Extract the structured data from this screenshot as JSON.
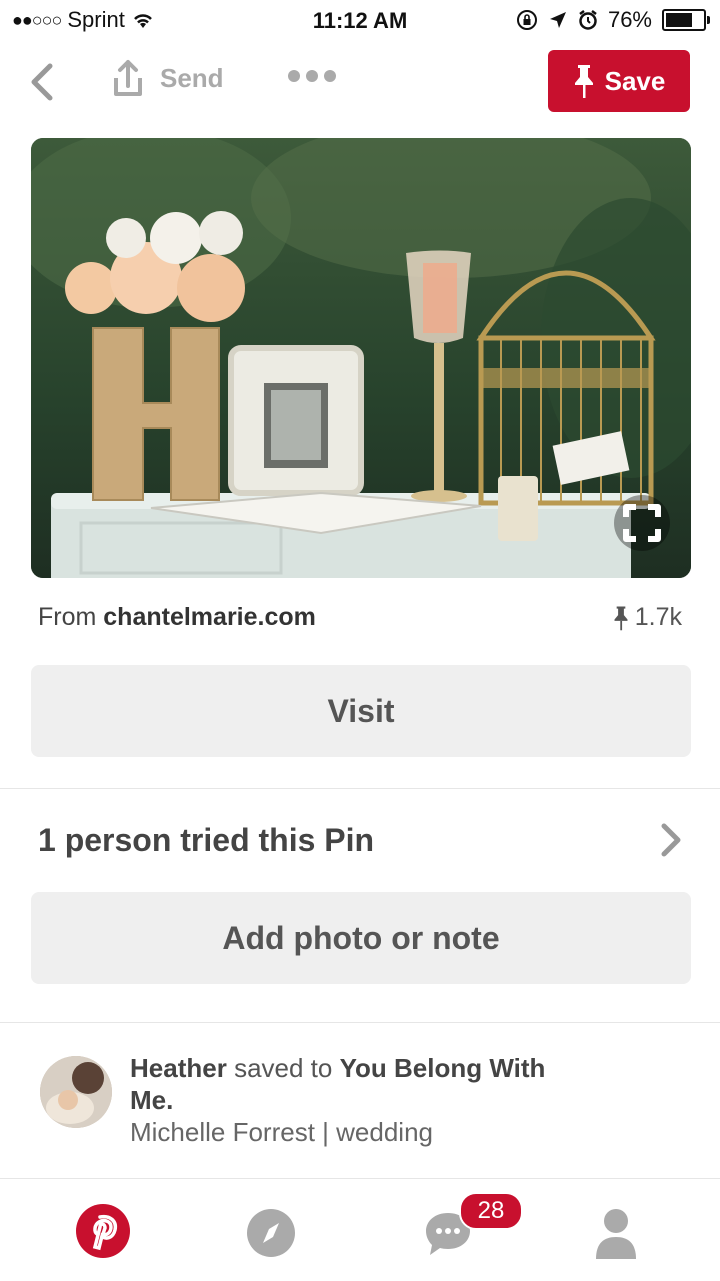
{
  "status_bar": {
    "signal": "●●○○○",
    "carrier": "Sprint",
    "time": "11:12 AM",
    "battery": "76%",
    "battery_level": 0.76
  },
  "nav": {
    "send_label": "Send",
    "save_label": "Save"
  },
  "pin": {
    "source_prefix": "From",
    "source_domain": "chantelmarie.com",
    "save_count": "1.7k"
  },
  "visit_label": "Visit",
  "tried": {
    "label": "1 person tried this Pin",
    "add_label": "Add photo or note"
  },
  "activity": {
    "user": "Heather",
    "verb": "saved to",
    "board": "You Belong With Me.",
    "subline": "Michelle Forrest | wedding"
  },
  "tabbar": {
    "items": [
      "pinterest-home-icon",
      "compass-explore-icon",
      "chat-bubble-icon",
      "profile-icon"
    ],
    "notification_count": "28"
  },
  "colors": {
    "brand_red": "#c8102e",
    "grey_button": "#efefef"
  }
}
